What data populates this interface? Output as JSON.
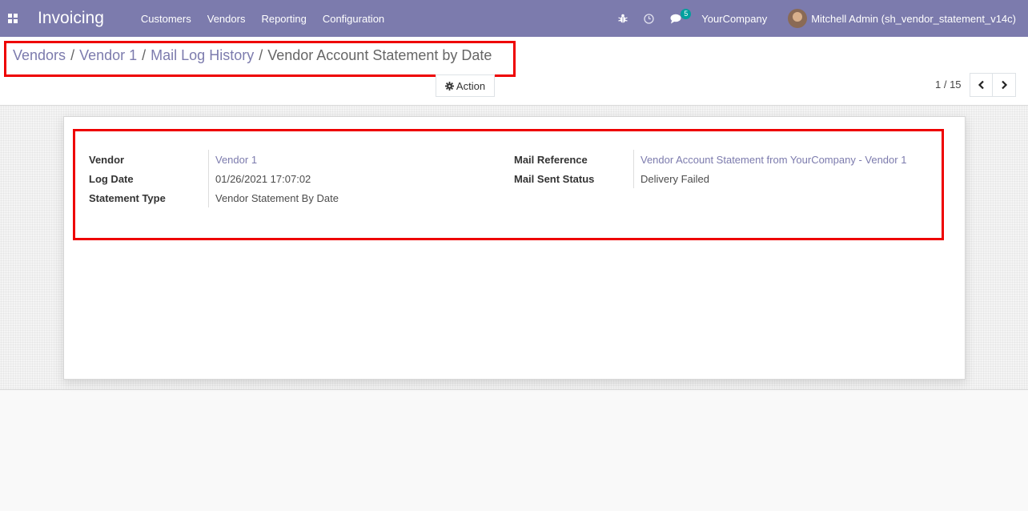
{
  "navbar": {
    "app_title": "Invoicing",
    "menu": [
      "Customers",
      "Vendors",
      "Reporting",
      "Configuration"
    ],
    "message_count": "5",
    "company": "YourCompany",
    "user": "Mitchell Admin (sh_vendor_statement_v14c)"
  },
  "breadcrumb": {
    "items": [
      "Vendors",
      "Vendor 1",
      "Mail Log History"
    ],
    "separator": "/",
    "current": "Vendor Account Statement by Date"
  },
  "toolbar": {
    "action_label": "Action",
    "pager_value": "1 / 15"
  },
  "form": {
    "left": [
      {
        "label": "Vendor",
        "value": "Vendor 1"
      },
      {
        "label": "Log Date",
        "value": "01/26/2021 17:07:02"
      },
      {
        "label": "Statement Type",
        "value": "Vendor Statement By Date"
      }
    ],
    "right": [
      {
        "label": "Mail Reference",
        "value": "Vendor Account Statement from YourCompany - Vendor 1"
      },
      {
        "label": "Mail Sent Status",
        "value": "Delivery Failed"
      }
    ]
  },
  "colors": {
    "navbar": "#7c7bad",
    "link": "#7c7bad",
    "highlight": "#ee0000",
    "badge": "#00a09d"
  }
}
